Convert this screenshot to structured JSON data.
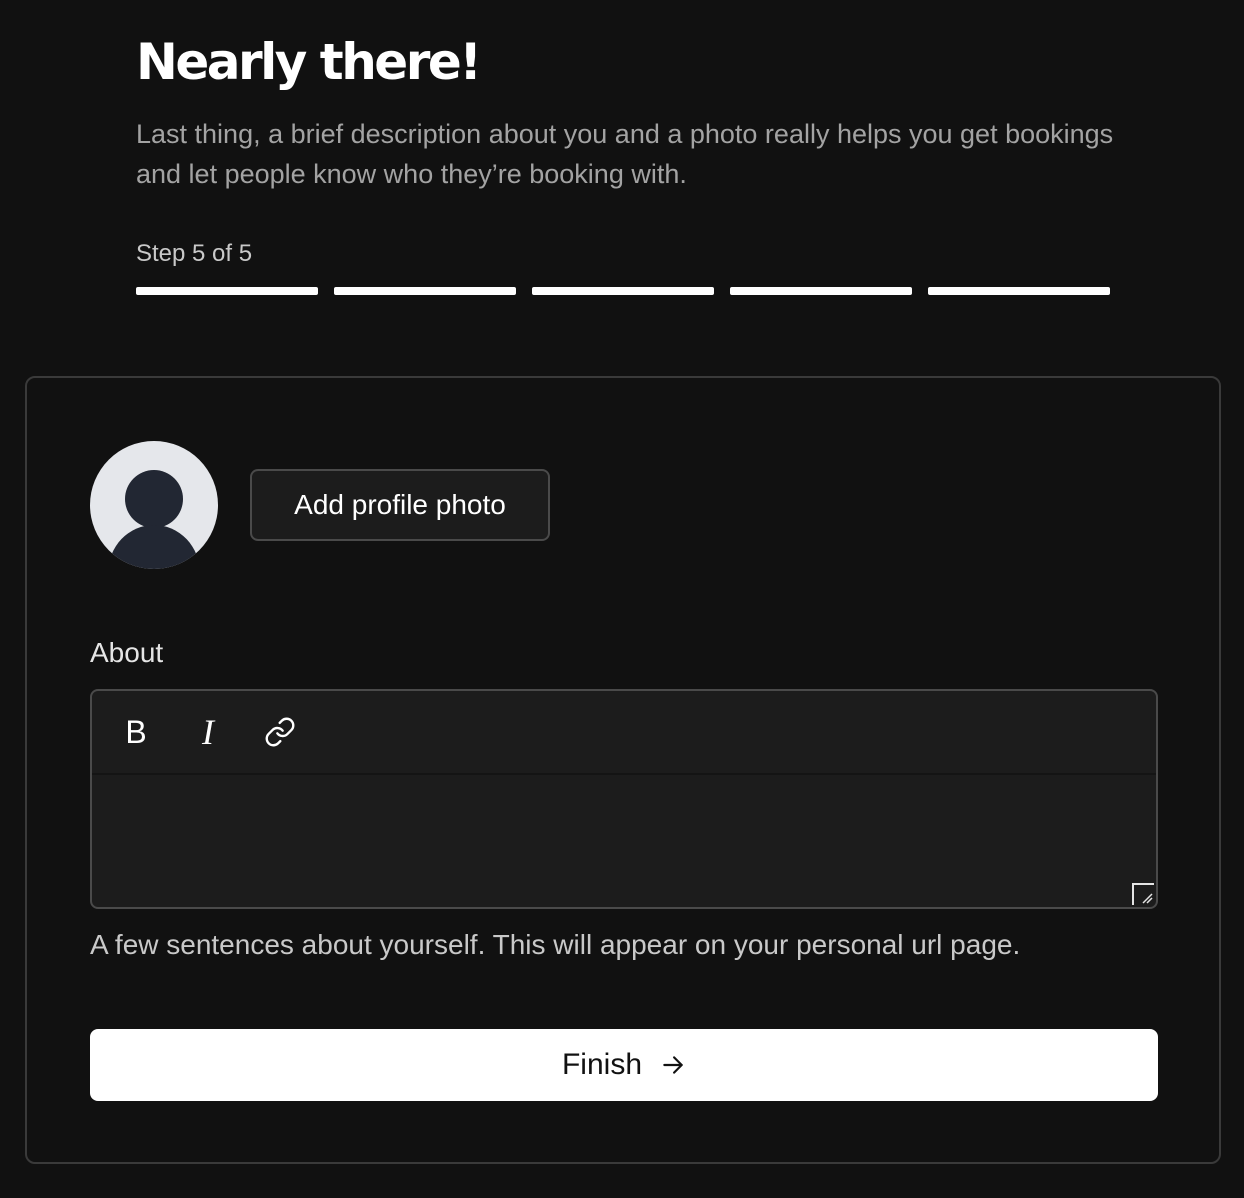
{
  "header": {
    "title": "Nearly there!",
    "subtitle": "Last thing, a brief description about you and a photo really helps you get bookings and let people know who they’re booking with."
  },
  "progress": {
    "label": "Step 5 of 5",
    "current_step": 5,
    "total_steps": 5
  },
  "profile": {
    "avatar_icon": "user-silhouette-icon",
    "add_photo_label": "Add profile photo"
  },
  "about": {
    "label": "About",
    "toolbar": {
      "bold_label": "B",
      "italic_label": "I",
      "link_icon": "link-icon"
    },
    "value": "",
    "helper_text": "A few sentences about yourself. This will appear on your personal url page."
  },
  "actions": {
    "finish_label": "Finish",
    "finish_icon": "arrow-right-icon"
  },
  "colors": {
    "background": "#111111",
    "card_border": "#3a3a3a",
    "accent": "#ffffff",
    "muted_text": "#a3a3a3"
  }
}
